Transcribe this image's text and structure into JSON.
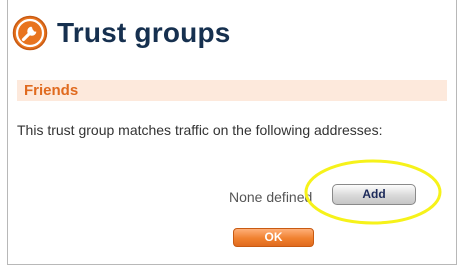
{
  "page": {
    "title": "Trust groups"
  },
  "group": {
    "name": "Friends",
    "description": "This trust group matches traffic on the following addresses:",
    "empty_text": "None defined"
  },
  "buttons": {
    "add_label": "Add",
    "ok_label": "OK"
  },
  "icons": {
    "header_icon": "wrench-icon",
    "highlight": "highlight-ellipse"
  },
  "colors": {
    "title": "#16304f",
    "accent_orange": "#e06a1f",
    "group_bar_bg": "#fde9dc",
    "highlight_yellow": "#f6f21a"
  }
}
